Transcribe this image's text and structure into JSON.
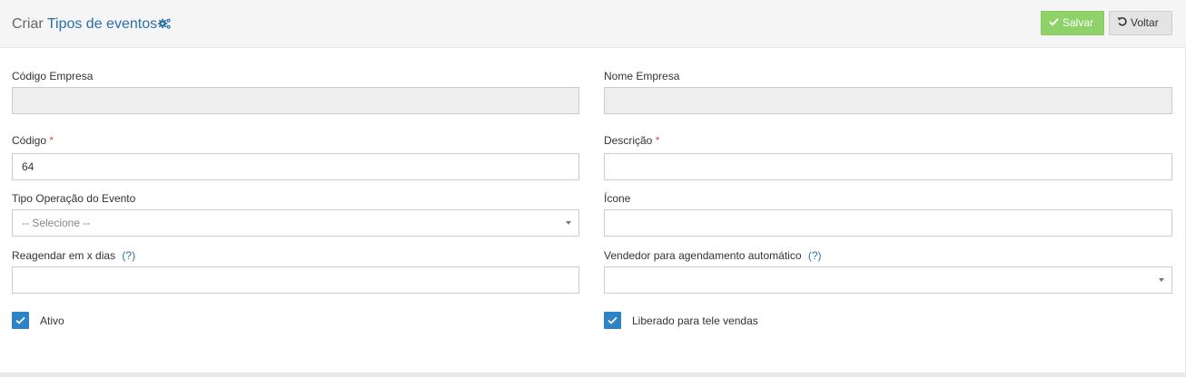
{
  "header": {
    "title_prefix": "Criar",
    "title_accent": "Tipos de eventos",
    "save_label": "Salvar",
    "back_label": "Voltar"
  },
  "form": {
    "codigo_empresa": {
      "label": "Código Empresa",
      "value": ""
    },
    "nome_empresa": {
      "label": "Nome Empresa",
      "value": ""
    },
    "codigo": {
      "label": "Código",
      "required_mark": "*",
      "value": "64"
    },
    "descricao": {
      "label": "Descrição",
      "required_mark": "*",
      "value": ""
    },
    "tipo_operacao": {
      "label": "Tipo Operação do Evento",
      "selected": "-- Selecione --"
    },
    "icone": {
      "label": "Ícone",
      "value": ""
    },
    "reagendar": {
      "label": "Reagendar em x dias",
      "help": "(?)",
      "value": ""
    },
    "vendedor": {
      "label": "Vendedor para agendamento automático",
      "help": "(?)",
      "selected": ""
    },
    "ativo": {
      "label": "Ativo",
      "checked": true
    },
    "tele_vendas": {
      "label": "Liberado para tele vendas",
      "checked": true
    }
  },
  "colors": {
    "accent": "#2b6fab",
    "save_button": "#8fd26a",
    "checkbox": "#2d83c5",
    "required": "#e04b4b"
  },
  "icons": {
    "title": "gears-icon",
    "save": "check-icon",
    "back": "undo-icon",
    "checkbox": "checkmark-icon",
    "select": "caret-down-icon"
  }
}
